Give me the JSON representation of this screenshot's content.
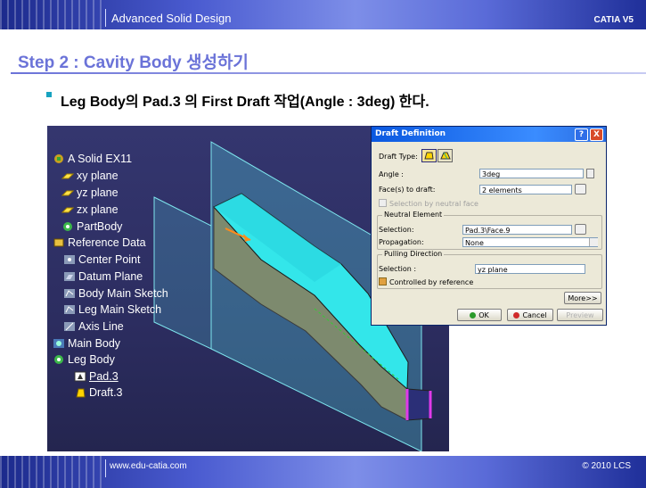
{
  "header": {
    "title": "Advanced Solid Design",
    "product": "CATIA V5"
  },
  "step": {
    "title": "Step 2 : Cavity Body 생성하기"
  },
  "task": {
    "text": "Leg Body의 Pad.3 의 First Draft 작업(Angle : 3deg) 한다."
  },
  "tree": {
    "nodes": [
      {
        "label": "A Solid EX11",
        "icon": "part-icon",
        "underline": false
      },
      {
        "label": "xy plane",
        "icon": "plane-icon",
        "underline": false
      },
      {
        "label": "yz plane",
        "icon": "plane-icon",
        "underline": false
      },
      {
        "label": "zx plane",
        "icon": "plane-icon",
        "underline": false
      },
      {
        "label": "PartBody",
        "icon": "body-icon",
        "underline": false
      },
      {
        "label": "Reference Data",
        "icon": "geometrical-set-icon",
        "underline": false
      },
      {
        "label": "Center Point",
        "icon": "point-icon",
        "underline": false
      },
      {
        "label": "Datum Plane",
        "icon": "plane-feature-icon",
        "underline": false
      },
      {
        "label": "Body Main Sketch",
        "icon": "sketch-icon",
        "underline": false
      },
      {
        "label": "Leg Main Sketch",
        "icon": "sketch-icon",
        "underline": false
      },
      {
        "label": "Axis Line",
        "icon": "line-icon",
        "underline": false
      },
      {
        "label": "Main Body",
        "icon": "body-icon",
        "underline": false
      },
      {
        "label": "Leg Body",
        "icon": "body-icon",
        "underline": false
      },
      {
        "label": "Pad.3",
        "icon": "pad-icon",
        "underline": true
      },
      {
        "label": "Draft.3",
        "icon": "draft-icon",
        "underline": false
      }
    ]
  },
  "dialog": {
    "title": "Draft Definition",
    "draft_type_label": "Draft Type:",
    "angle_label": "Angle :",
    "angle_value": "3deg",
    "faces_label": "Face(s) to draft:",
    "faces_value": "2 elements",
    "neutral_face_checkbox": "Selection by neutral face",
    "neutral_element_group": "Neutral Element",
    "selection_label": "Selection:",
    "selection_value": "Pad.3\\Face.9",
    "propagation_label": "Propagation:",
    "propagation_value": "None",
    "pulling_direction_group": "Pulling Direction",
    "pulling_selection_label": "Selection :",
    "pulling_selection_value": "yz plane",
    "controlled_by_reference": "Controlled by reference",
    "more_button": "More>>",
    "ok_button": "OK",
    "cancel_button": "Cancel",
    "preview_button": "Preview",
    "help_button": "?",
    "close_button": "X"
  },
  "footer": {
    "url": "www.edu-catia.com",
    "copyright": "© 2010 LCS"
  },
  "colors": {
    "accent_title": "#6b73d8",
    "header_blue": "#1c2a8c",
    "viewport_bg": "#2c2d60",
    "model_cyan": "#33e6ea",
    "dialog_titlebar": "#0a58e0"
  }
}
